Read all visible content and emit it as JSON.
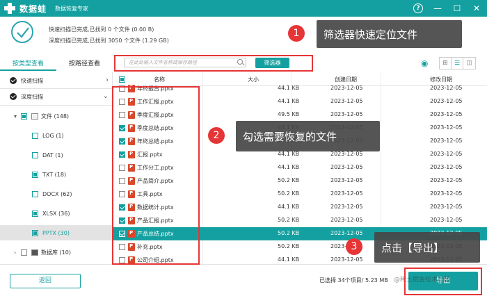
{
  "app": {
    "name": "数据蛙",
    "subtitle": "数据恢复专家",
    "help": "?",
    "minimize": "—",
    "maximize": "☐",
    "close": "✕"
  },
  "scan": {
    "quick": "快速扫描已完成,已找到 0 个文件 (0.00  B)",
    "deep": "深度扫描已完成,已找到 3050 个文件 (1.29 GB)"
  },
  "tabs": [
    "按类型查看",
    "按路径查看"
  ],
  "search": {
    "placeholder": "在此处输入文件名称或保存路径",
    "filter_label": "筛选器"
  },
  "view_icons": [
    "⊞",
    "☰",
    "◫"
  ],
  "sidebar": {
    "quick": "快速扫描",
    "deep": "深度扫描",
    "files": "文件 (148)",
    "types": [
      "LOG (1)",
      "DAT (1)",
      "TXT (18)",
      "DOCX (62)",
      "XLSX (36)",
      "PPTX (30)"
    ],
    "db": "数据库 (10)"
  },
  "table": {
    "headers": {
      "name": "名称",
      "size": "大小",
      "created": "创建日期",
      "modified": "修改日期"
    },
    "rows": [
      {
        "name": "年终报告.pptx",
        "size": "44.1 KB",
        "created": "2023-12-05",
        "modified": "2023-12-05",
        "checked": false
      },
      {
        "name": "工作汇报.pptx",
        "size": "44.1 KB",
        "created": "2023-12-05",
        "modified": "2023-12-05",
        "checked": false
      },
      {
        "name": "季度汇报.pptx",
        "size": "49.5 KB",
        "created": "2023-12-05",
        "modified": "2023-12-05",
        "checked": false
      },
      {
        "name": "季度总结.pptx",
        "size": "44.1 KB",
        "created": "2023-12-05",
        "modified": "2023-12-05",
        "checked": true
      },
      {
        "name": "年终总结.pptx",
        "size": "44.1 KB",
        "created": "2023-12-05",
        "modified": "2023-12-05",
        "checked": true
      },
      {
        "name": "汇报.pptx",
        "size": "44.1 KB",
        "created": "2023-12-05",
        "modified": "2023-12-05",
        "checked": true
      },
      {
        "name": "工作分工.pptx",
        "size": "44.1 KB",
        "created": "2023-12-05",
        "modified": "2023-12-05",
        "checked": false
      },
      {
        "name": "产品简介.pptx",
        "size": "50.2 KB",
        "created": "2023-12-05",
        "modified": "2023-12-05",
        "checked": false
      },
      {
        "name": "工具.pptx",
        "size": "50.2 KB",
        "created": "2023-12-05",
        "modified": "2023-12-05",
        "checked": false
      },
      {
        "name": "数据统计.pptx",
        "size": "44.1 KB",
        "created": "2023-12-05",
        "modified": "2023-12-05",
        "checked": true
      },
      {
        "name": "产品汇报.pptx",
        "size": "50.2 KB",
        "created": "2023-12-05",
        "modified": "2023-12-05",
        "checked": true
      },
      {
        "name": "产品总结.pptx",
        "size": "50.2 KB",
        "created": "2023-12-05",
        "modified": "2023-12-05",
        "checked": true
      },
      {
        "name": "补充.pptx",
        "size": "50.2 KB",
        "created": "2023-12-05",
        "modified": "2023-12-05",
        "checked": false
      },
      {
        "name": "公司介绍.pptx",
        "size": "44.1 KB",
        "created": "2023-12-05",
        "modified": "2023-12-05",
        "checked": false
      }
    ],
    "highlighted_row": 11
  },
  "footer": {
    "back": "返回",
    "selection": "已选择 34个项目/ 5.23 MB",
    "export": "导出",
    "watermark": "@稀土掘金技术社区"
  },
  "annotations": {
    "step1": {
      "num": "1",
      "text": "筛选器快速定位文件"
    },
    "step2": {
      "num": "2",
      "text": "勾选需要恢复的文件"
    },
    "step3": {
      "num": "3",
      "text": "点击【导出】"
    }
  },
  "colors": {
    "accent": "#14a0a0",
    "annotation_red": "#e63536",
    "callout_bg": "#464646"
  }
}
